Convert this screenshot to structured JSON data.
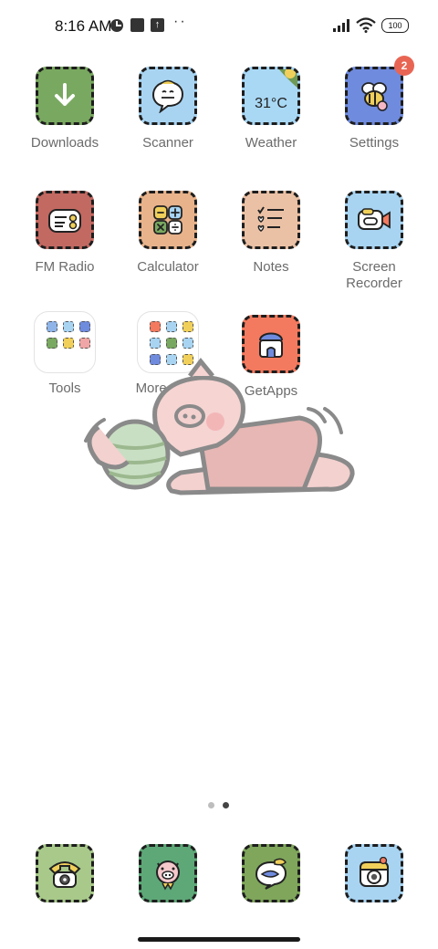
{
  "status_bar": {
    "time": "8:16 AM",
    "battery": "100",
    "icons": [
      "data-saver-icon",
      "square-notification-icon",
      "upload-notification-icon",
      "more-dots-icon",
      "signal-icon",
      "wifi-icon",
      "battery-icon"
    ]
  },
  "apps": [
    {
      "label": "Downloads",
      "color": "#79a860",
      "icon": "download-arrow-icon"
    },
    {
      "label": "Scanner",
      "color": "#a8d4f2",
      "icon": "scanner-chat-icon"
    },
    {
      "label": "Weather",
      "color": "#a9d8f5",
      "icon": "weather-temp-icon",
      "temp": "31°C"
    },
    {
      "label": "Settings",
      "color": "#6f8bde",
      "icon": "bee-gear-icon",
      "badge": "2"
    },
    {
      "label": "FM Radio",
      "color": "#c26962",
      "icon": "radio-icon"
    },
    {
      "label": "Calculator",
      "color": "#e8b38b",
      "icon": "calculator-icon"
    },
    {
      "label": "Notes",
      "color": "#ebc1a5",
      "icon": "notes-list-icon"
    },
    {
      "label": "Screen Recorder",
      "label_line1": "Screen",
      "label_line2": "Recorder",
      "color": "#a8d4f2",
      "icon": "video-camera-icon"
    },
    {
      "label": "GetApps",
      "color": "#f37a5f",
      "icon": "store-icon"
    }
  ],
  "folders": [
    {
      "label": "Tools",
      "minis": [
        "#8fb4e8",
        "#a8d4f2",
        "#6f8bde",
        "#79a860",
        "#f0d05a",
        "#f0a6a6",
        "#e8b38b",
        "#c9c9c9",
        "#a8d4f2"
      ]
    },
    {
      "label": "More apps",
      "minis": [
        "#f37a5f",
        "#a8d4f2",
        "#f0d05a",
        "#a8d4f2",
        "#79a860",
        "#a8d4f2",
        "#6f8bde",
        "#a8d4f2",
        "#f0d05a"
      ]
    }
  ],
  "dock": [
    {
      "name": "phone",
      "color": "#a8c98a",
      "icon": "telephone-icon"
    },
    {
      "name": "messages",
      "color": "#5ea878",
      "icon": "pig-face-icon"
    },
    {
      "name": "browser",
      "color": "#7fa65b",
      "icon": "chat-bubble-icon"
    },
    {
      "name": "camera",
      "color": "#a8d4f2",
      "icon": "camera-icon"
    }
  ],
  "page_indicator": {
    "count": 2,
    "active": 2
  }
}
